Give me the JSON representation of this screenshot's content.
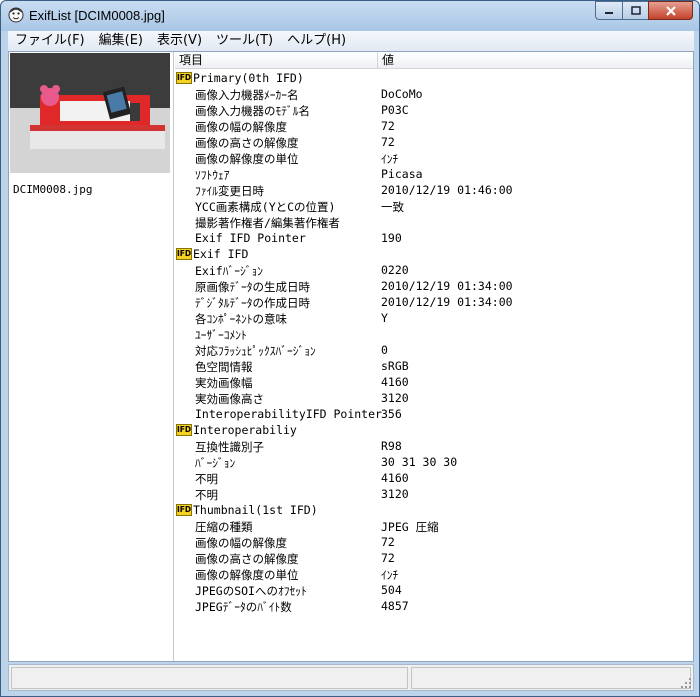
{
  "window": {
    "title": "ExifList [DCIM0008.jpg]",
    "icon": "app-face-icon"
  },
  "controls": {
    "minimize": "minimize-icon",
    "maximize": "maximize-icon",
    "close": "close-icon"
  },
  "menu": [
    {
      "label": "ファイル(F)"
    },
    {
      "label": "編集(E)"
    },
    {
      "label": "表示(V)"
    },
    {
      "label": "ツール(T)"
    },
    {
      "label": "ヘルプ(H)"
    }
  ],
  "preview": {
    "filename": "DCIM0008.jpg"
  },
  "list": {
    "columns": {
      "key": "項目",
      "value": "値"
    },
    "ifd_badge": "IFD",
    "rows": [
      {
        "group": true,
        "key": "Primary(0th IFD)",
        "value": ""
      },
      {
        "group": false,
        "key": "画像入力機器ﾒｰｶｰ名",
        "value": "DoCoMo"
      },
      {
        "group": false,
        "key": "画像入力機器のﾓﾃﾞﾙ名",
        "value": "P03C"
      },
      {
        "group": false,
        "key": "画像の幅の解像度",
        "value": "72"
      },
      {
        "group": false,
        "key": "画像の高さの解像度",
        "value": "72"
      },
      {
        "group": false,
        "key": "画像の解像度の単位",
        "value": "ｲﾝﾁ"
      },
      {
        "group": false,
        "key": "ｿﾌﾄｳｪｱ",
        "value": "Picasa"
      },
      {
        "group": false,
        "key": "ﾌｧｲﾙ変更日時",
        "value": "2010/12/19 01:46:00"
      },
      {
        "group": false,
        "key": "YCC画素構成(YとCの位置)",
        "value": "一致"
      },
      {
        "group": false,
        "key": "撮影著作権者/編集著作権者",
        "value": ""
      },
      {
        "group": false,
        "key": "Exif IFD Pointer",
        "value": "190"
      },
      {
        "group": true,
        "key": "Exif IFD",
        "value": ""
      },
      {
        "group": false,
        "key": "Exifﾊﾞｰｼﾞｮﾝ",
        "value": "0220"
      },
      {
        "group": false,
        "key": "原画像ﾃﾞｰﾀの生成日時",
        "value": "2010/12/19 01:34:00"
      },
      {
        "group": false,
        "key": "ﾃﾞｼﾞﾀﾙﾃﾞｰﾀの作成日時",
        "value": "2010/12/19 01:34:00"
      },
      {
        "group": false,
        "key": "各ｺﾝﾎﾟｰﾈﾝﾄの意味",
        "value": "Y"
      },
      {
        "group": false,
        "key": "ﾕｰｻﾞｰｺﾒﾝﾄ",
        "value": ""
      },
      {
        "group": false,
        "key": "対応ﾌﾗｯｼｭﾋﾟｯｸｽﾊﾞｰｼﾞｮﾝ",
        "value": "0"
      },
      {
        "group": false,
        "key": "色空間情報",
        "value": "sRGB"
      },
      {
        "group": false,
        "key": "実効画像幅",
        "value": "4160"
      },
      {
        "group": false,
        "key": "実効画像高さ",
        "value": "3120"
      },
      {
        "group": false,
        "key": "InteroperabilityIFD Pointer",
        "value": "356"
      },
      {
        "group": true,
        "key": "Interoperabiliy",
        "value": ""
      },
      {
        "group": false,
        "key": "互換性識別子",
        "value": "R98"
      },
      {
        "group": false,
        "key": "ﾊﾞｰｼﾞｮﾝ",
        "value": "30 31 30 30"
      },
      {
        "group": false,
        "key": "不明",
        "value": "4160"
      },
      {
        "group": false,
        "key": "不明",
        "value": "3120"
      },
      {
        "group": true,
        "key": "Thumbnail(1st IFD)",
        "value": ""
      },
      {
        "group": false,
        "key": "圧縮の種類",
        "value": "JPEG 圧縮"
      },
      {
        "group": false,
        "key": "画像の幅の解像度",
        "value": "72"
      },
      {
        "group": false,
        "key": "画像の高さの解像度",
        "value": "72"
      },
      {
        "group": false,
        "key": "画像の解像度の単位",
        "value": "ｲﾝﾁ"
      },
      {
        "group": false,
        "key": "JPEGのSOIへのｵﾌｾｯﾄ",
        "value": "504"
      },
      {
        "group": false,
        "key": "JPEGﾃﾞｰﾀのﾊﾞｲﾄ数",
        "value": "4857"
      }
    ]
  }
}
